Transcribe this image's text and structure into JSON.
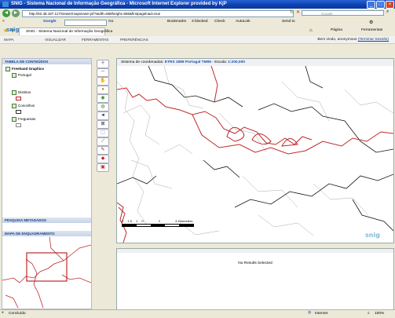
{
  "window": {
    "title": "SNIG - Sistema Nacional de Informação Geográfica - Microsoft Internet Explorer provided by KjP"
  },
  "address": {
    "url": "http://62.48.187.117/viewer/mapviewer.jsf?width=868height=586&firstpageload=true",
    "search_placeholder": "Google"
  },
  "google_toolbar": {
    "brand": "Google",
    "go_label": "Go",
    "bookmarks": "Bookmarks",
    "blocked": "3 blocked",
    "check": "Check",
    "autolink": "AutoLink",
    "sendto": "Send to"
  },
  "favbar": {
    "tab_label": "SNIG - Sistema Nacional de Informação Geográfica",
    "pagina": "Página",
    "ferramentas": "Ferramentas"
  },
  "menu": {
    "items": [
      "MAPA",
      "VISUALIZAR",
      "FERRAMENTAS",
      "PREFERÊNCIAS"
    ],
    "welcome": "Bem vindo, anonymous",
    "logout": "(Terminar Sessão)"
  },
  "logo": {
    "text": "snig"
  },
  "toc": {
    "header": "TABELA DE CONTEÚDOS",
    "layers": [
      "Freehand Graphics",
      "Portugal",
      "Distritos",
      "Concelhos",
      "Freguesias"
    ]
  },
  "search_panel": {
    "header": "PESQUISA METADADOS"
  },
  "overview_panel": {
    "header": "MAPA DE ENQUADRAMENTO"
  },
  "map": {
    "coord_label": "Sistema de coordenadas:",
    "coord_value": "ETRS 1989 Portugal TM06",
    "scale_label": "- Escala:",
    "scale_value": "1:200,000",
    "scalebar_ticks": [
      "2",
      "1.5",
      "1",
      "0",
      "2",
      "4 Kilometers"
    ],
    "watermark": "snig"
  },
  "results": {
    "message": "No Results Selected"
  },
  "status": {
    "left": "Concluído",
    "zone": "Internet",
    "zoom": "100%"
  },
  "colors": {
    "titlebar": "#0a3fb0",
    "panel_header": "#15428b",
    "boundary_red": "#c0282a",
    "boundary_black": "#111111"
  }
}
